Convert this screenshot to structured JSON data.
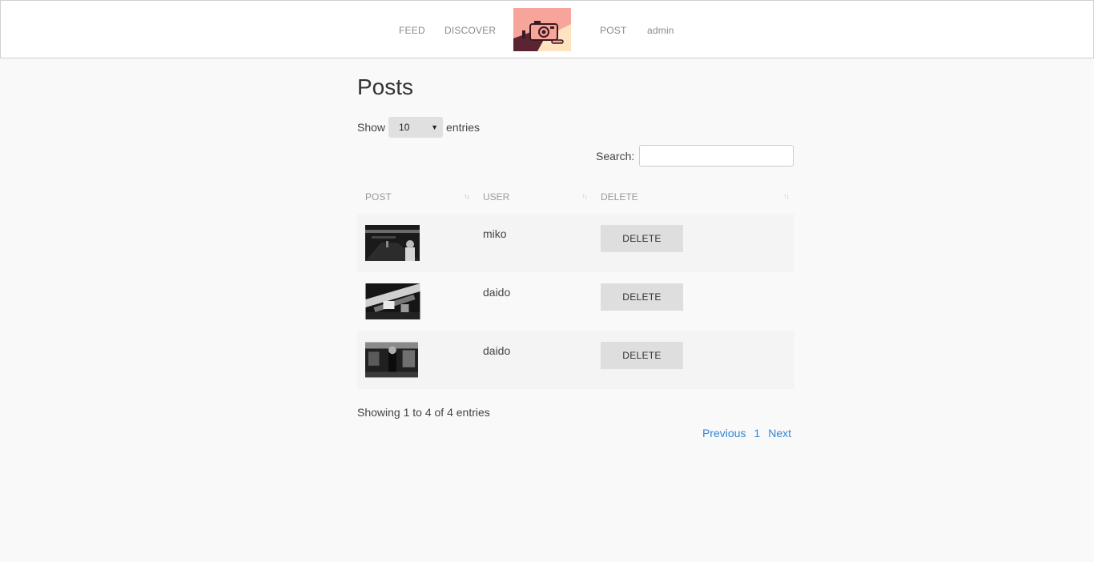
{
  "nav": {
    "left": [
      "FEED",
      "DISCOVER"
    ],
    "right": [
      "POST",
      "admin"
    ],
    "logo_icon": "camera-logo"
  },
  "page": {
    "title": "Posts"
  },
  "length_control": {
    "show_label": "Show",
    "selected": "10",
    "entries_label": "entries"
  },
  "search": {
    "label": "Search:",
    "value": "",
    "placeholder": ""
  },
  "table": {
    "columns": [
      "POST",
      "USER",
      "DELETE"
    ],
    "rows": [
      {
        "thumbnail": "photo-thumbnail",
        "user": "miko",
        "action": "DELETE"
      },
      {
        "thumbnail": "photo-thumbnail",
        "user": "daido",
        "action": "DELETE"
      },
      {
        "thumbnail": "photo-thumbnail",
        "user": "daido",
        "action": "DELETE"
      }
    ]
  },
  "footer": {
    "info": "Showing 1 to 4 of 4 entries",
    "prev": "Previous",
    "page": "1",
    "next": "Next"
  },
  "colors": {
    "link": "#2e86d6",
    "logo_pink": "#f7a59a",
    "logo_maroon": "#5a2432",
    "logo_cream": "#fde3c0"
  }
}
